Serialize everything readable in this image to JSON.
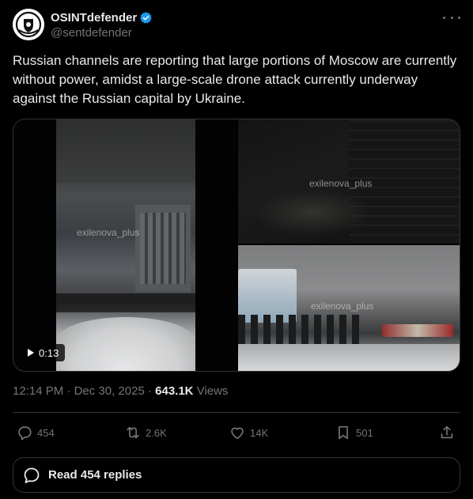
{
  "author": {
    "display_name": "OSINTdefender",
    "handle": "@sentdefender",
    "verified": true,
    "avatar": "shield-logo",
    "verified_color": "#1d9bf0"
  },
  "tweet": {
    "text": "Russian channels are reporting that large portions of Moscow are currently without power, amidst a large-scale drone attack currently underway against the Russian capital by Ukraine."
  },
  "media": {
    "video_duration": "0:13",
    "watermarks": [
      "exilenova_plus",
      "exilenova_plus",
      "exilenova_plus"
    ]
  },
  "meta": {
    "time": "12:14 PM",
    "separator": "·",
    "date": "Dec 30, 2025",
    "views_count": "643.1K",
    "views_label": "Views"
  },
  "actions": {
    "replies": "454",
    "reposts": "2.6K",
    "likes": "14K",
    "bookmarks": "501"
  },
  "read_replies_label": "Read 454 replies"
}
